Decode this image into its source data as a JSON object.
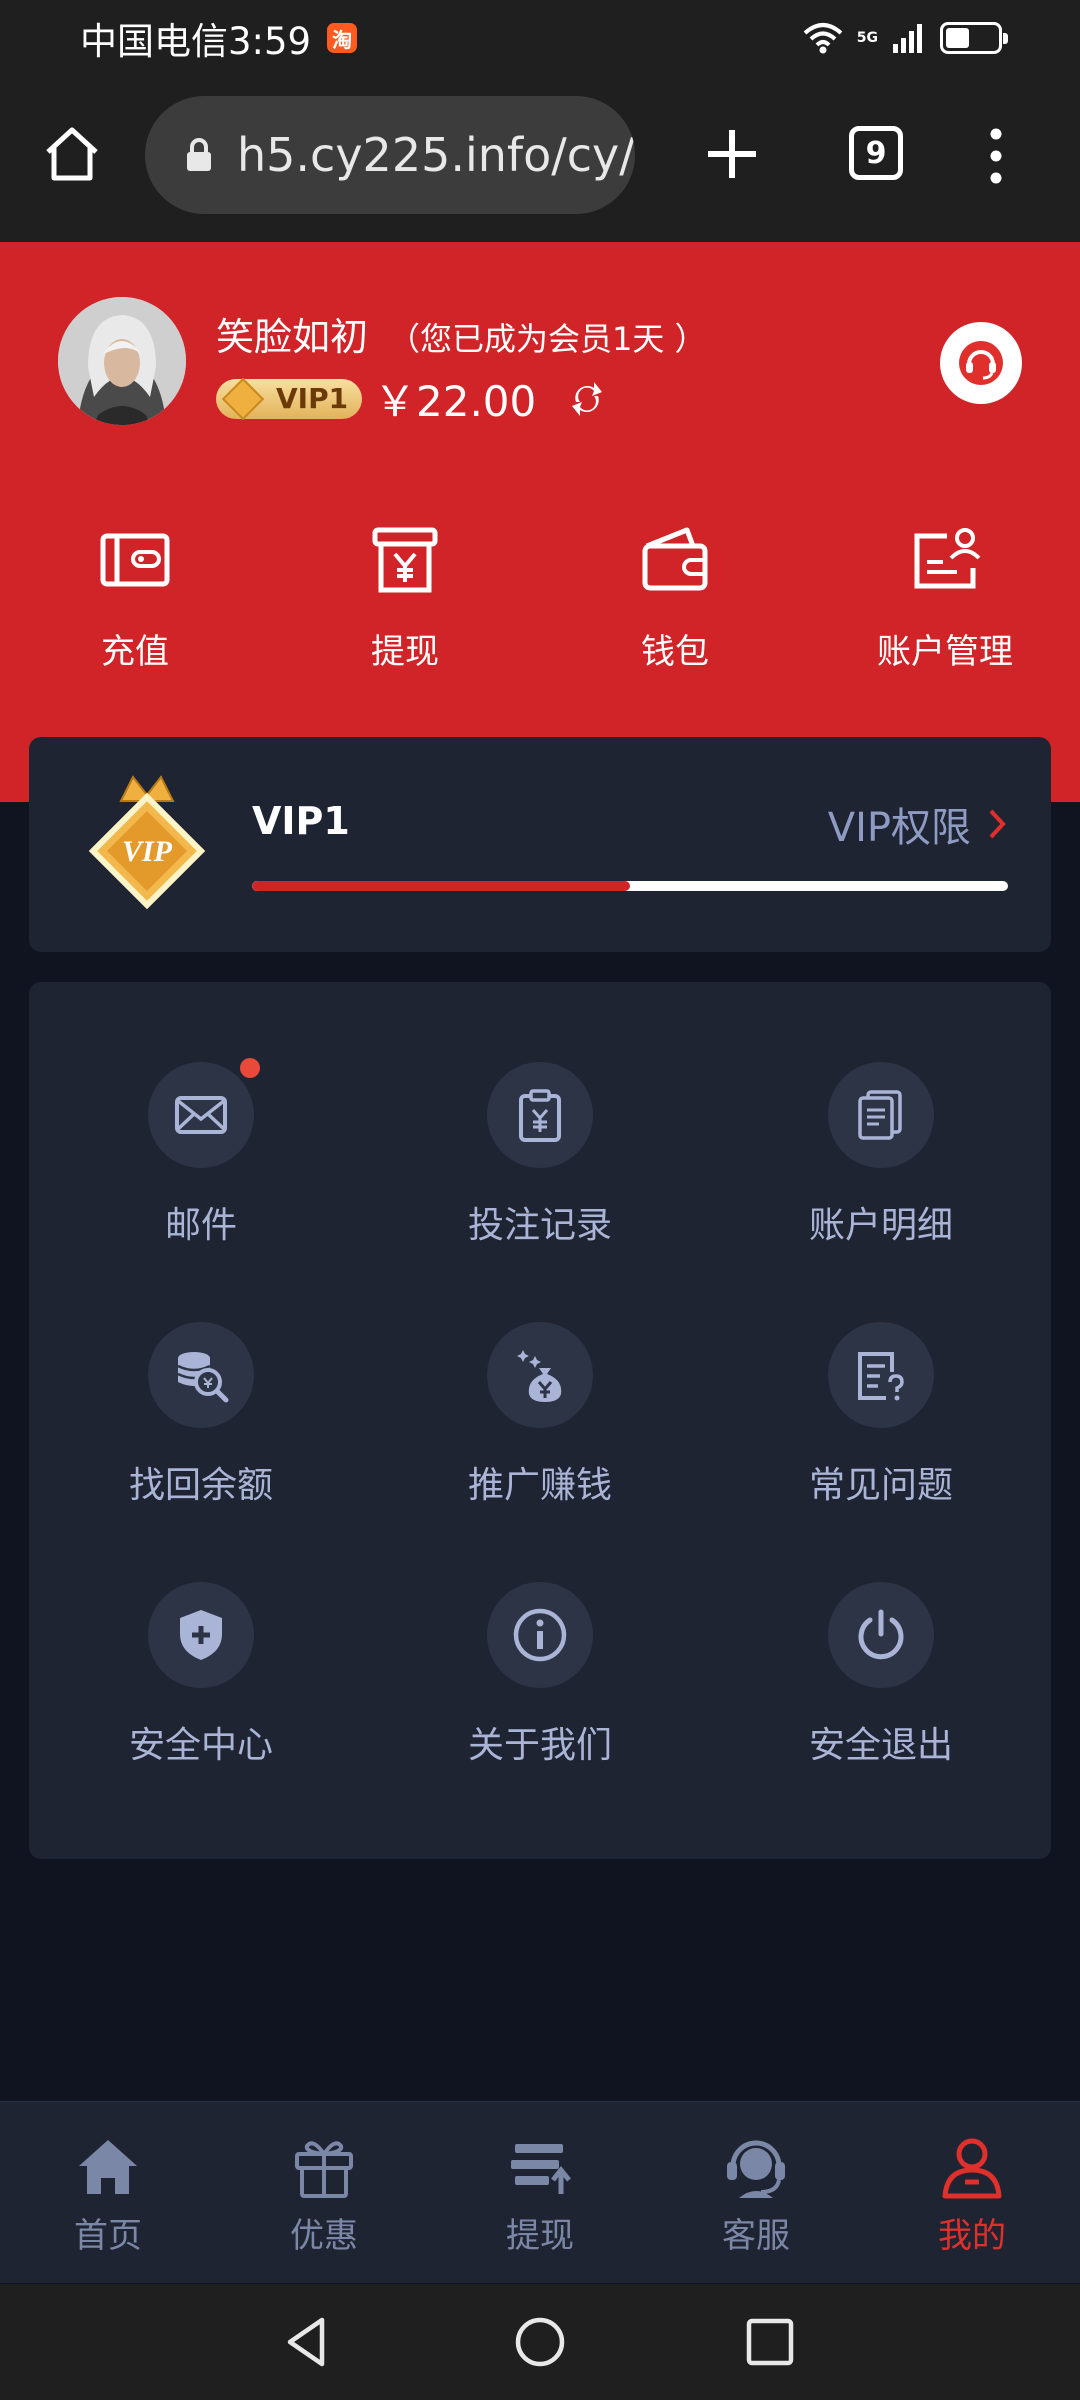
{
  "status_bar": {
    "carrier_time": "中国电信3:59",
    "app_badge": "淘",
    "network": "5G",
    "battery_level": 0.45
  },
  "browser": {
    "url": "h5.cy225.info/cy/",
    "tab_count": "9"
  },
  "profile": {
    "username": "笑脸如初",
    "member_note": "（您已成为会员1天 ）",
    "vip_chip": "VIP1",
    "balance": "￥22.00"
  },
  "quick_actions": [
    {
      "label": "充值",
      "icon": "recharge-wallet-icon"
    },
    {
      "label": "提现",
      "icon": "withdraw-yen-icon"
    },
    {
      "label": "钱包",
      "icon": "wallet-icon"
    },
    {
      "label": "账户管理",
      "icon": "account-card-icon"
    }
  ],
  "vip": {
    "level": "VIP1",
    "rights_label": "VIP权限",
    "progress": 0.5
  },
  "menu": [
    {
      "label": "邮件",
      "icon": "mail-icon",
      "notify": true
    },
    {
      "label": "投注记录",
      "icon": "clipboard-yen-icon"
    },
    {
      "label": "账户明细",
      "icon": "documents-icon"
    },
    {
      "label": "找回余额",
      "icon": "coin-search-icon"
    },
    {
      "label": "推广赚钱",
      "icon": "money-bag-icon"
    },
    {
      "label": "常见问题",
      "icon": "faq-icon"
    },
    {
      "label": "安全中心",
      "icon": "shield-icon"
    },
    {
      "label": "关于我们",
      "icon": "info-icon"
    },
    {
      "label": "安全退出",
      "icon": "power-icon"
    }
  ],
  "tabs": [
    {
      "label": "首页",
      "icon": "home-icon"
    },
    {
      "label": "优惠",
      "icon": "gift-icon"
    },
    {
      "label": "提现",
      "icon": "withdraw-icon"
    },
    {
      "label": "客服",
      "icon": "headset-icon"
    },
    {
      "label": "我的",
      "icon": "user-icon",
      "active": true
    }
  ],
  "colors": {
    "brand_red": "#d12428",
    "card_bg": "#1f2433",
    "page_bg": "#0f1420",
    "muted_text": "#aab4d6"
  }
}
